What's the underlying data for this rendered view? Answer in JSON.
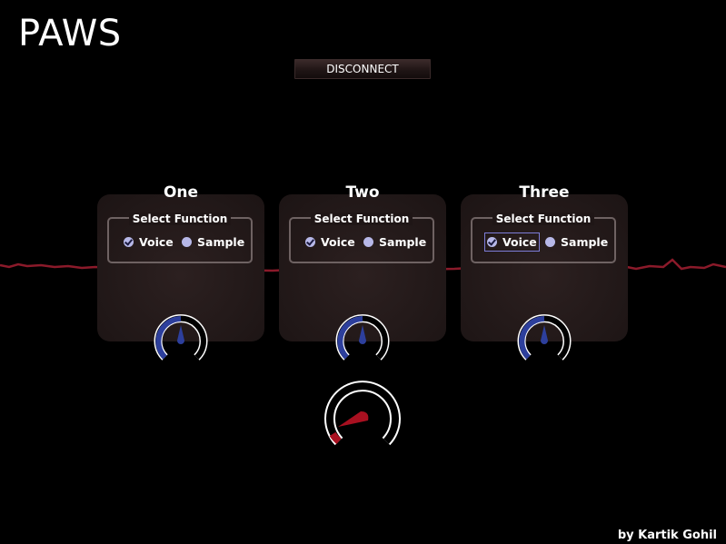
{
  "app": {
    "title": "PAWS"
  },
  "toolbar": {
    "disconnect_label": "DISCONNECT"
  },
  "panels": [
    {
      "title": "One",
      "legend": "Select Function",
      "voice_label": "Voice",
      "sample_label": "Sample",
      "selected": "Voice",
      "focused": false
    },
    {
      "title": "Two",
      "legend": "Select Function",
      "voice_label": "Voice",
      "sample_label": "Sample",
      "selected": "Voice",
      "focused": false
    },
    {
      "title": "Three",
      "legend": "Select Function",
      "voice_label": "Voice",
      "sample_label": "Sample",
      "selected": "Voice",
      "focused": true
    }
  ],
  "knobs": {
    "channel_levels": [
      0.5,
      0.5,
      0.5
    ],
    "master_level": 0.1
  },
  "footer": {
    "credit": "by Kartik Gohil"
  },
  "colors": {
    "background": "#000000",
    "waveform": "#8b1a2a",
    "knob_channel": "#2d3f9c",
    "knob_master": "#a81020",
    "radio": "#b7b8e8"
  }
}
